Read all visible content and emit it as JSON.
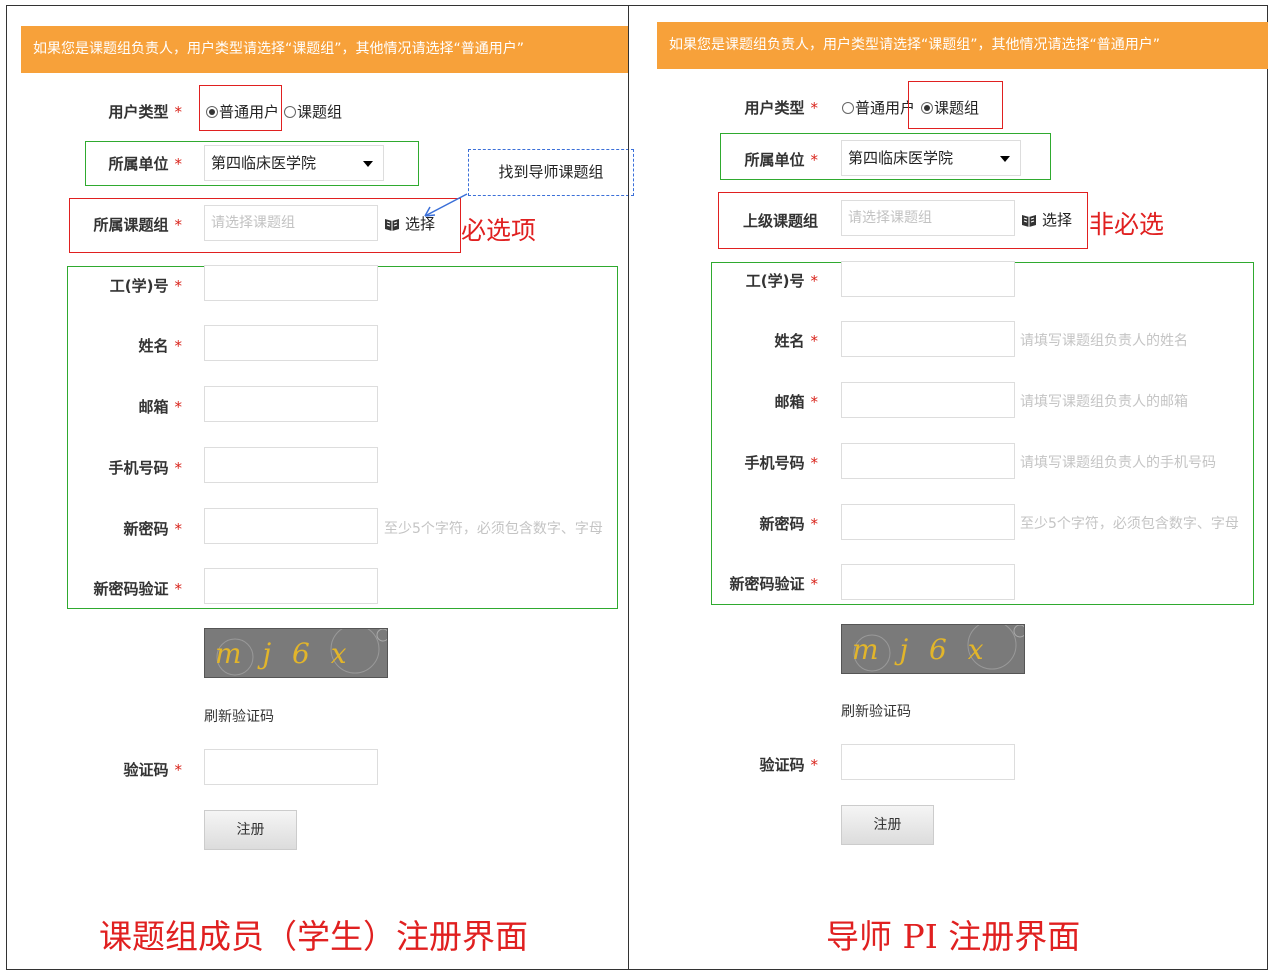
{
  "banner_text": "如果您是课题组负责人，用户类型请选择“课题组”，其他情况请选择“普通用户”",
  "labels": {
    "user_type": "用户类型",
    "unit": "所属单位",
    "group_required": "所属课题组",
    "group_parent": "上级课题组",
    "job_id": "工(学)号",
    "name": "姓名",
    "email": "邮箱",
    "phone": "手机号码",
    "new_password": "新密码",
    "confirm_password": "新密码验证",
    "captcha": "验证码",
    "required_mark": "*"
  },
  "radio_options": {
    "normal_user": "普通用户",
    "research_group": "课题组"
  },
  "unit_selected": "第四临床医学院",
  "placeholders": {
    "group": "请选择课题组"
  },
  "choose_label": "选择",
  "hints": {
    "name": "请填写课题组负责人的姓名",
    "email": "请填写课题组负责人的邮箱",
    "phone": "请填写课题组负责人的手机号码",
    "password": "至少5个字符，必须包含数字、字母"
  },
  "captcha_image_text": "m j 6 x",
  "refresh_captcha": "刷新验证码",
  "register_button": "注册",
  "annotations": {
    "callout_find_group": "找到导师课题组",
    "required_item": "必选项",
    "optional_item": "非必选"
  },
  "captions": {
    "left": "课题组成员（学生）注册界面",
    "right": "导师 PI 注册界面"
  },
  "colors": {
    "banner": "#f7a13a",
    "annotation_red": "#e02020",
    "annotation_green": "#2faa2f",
    "callout_blue": "#3a6fd8"
  }
}
